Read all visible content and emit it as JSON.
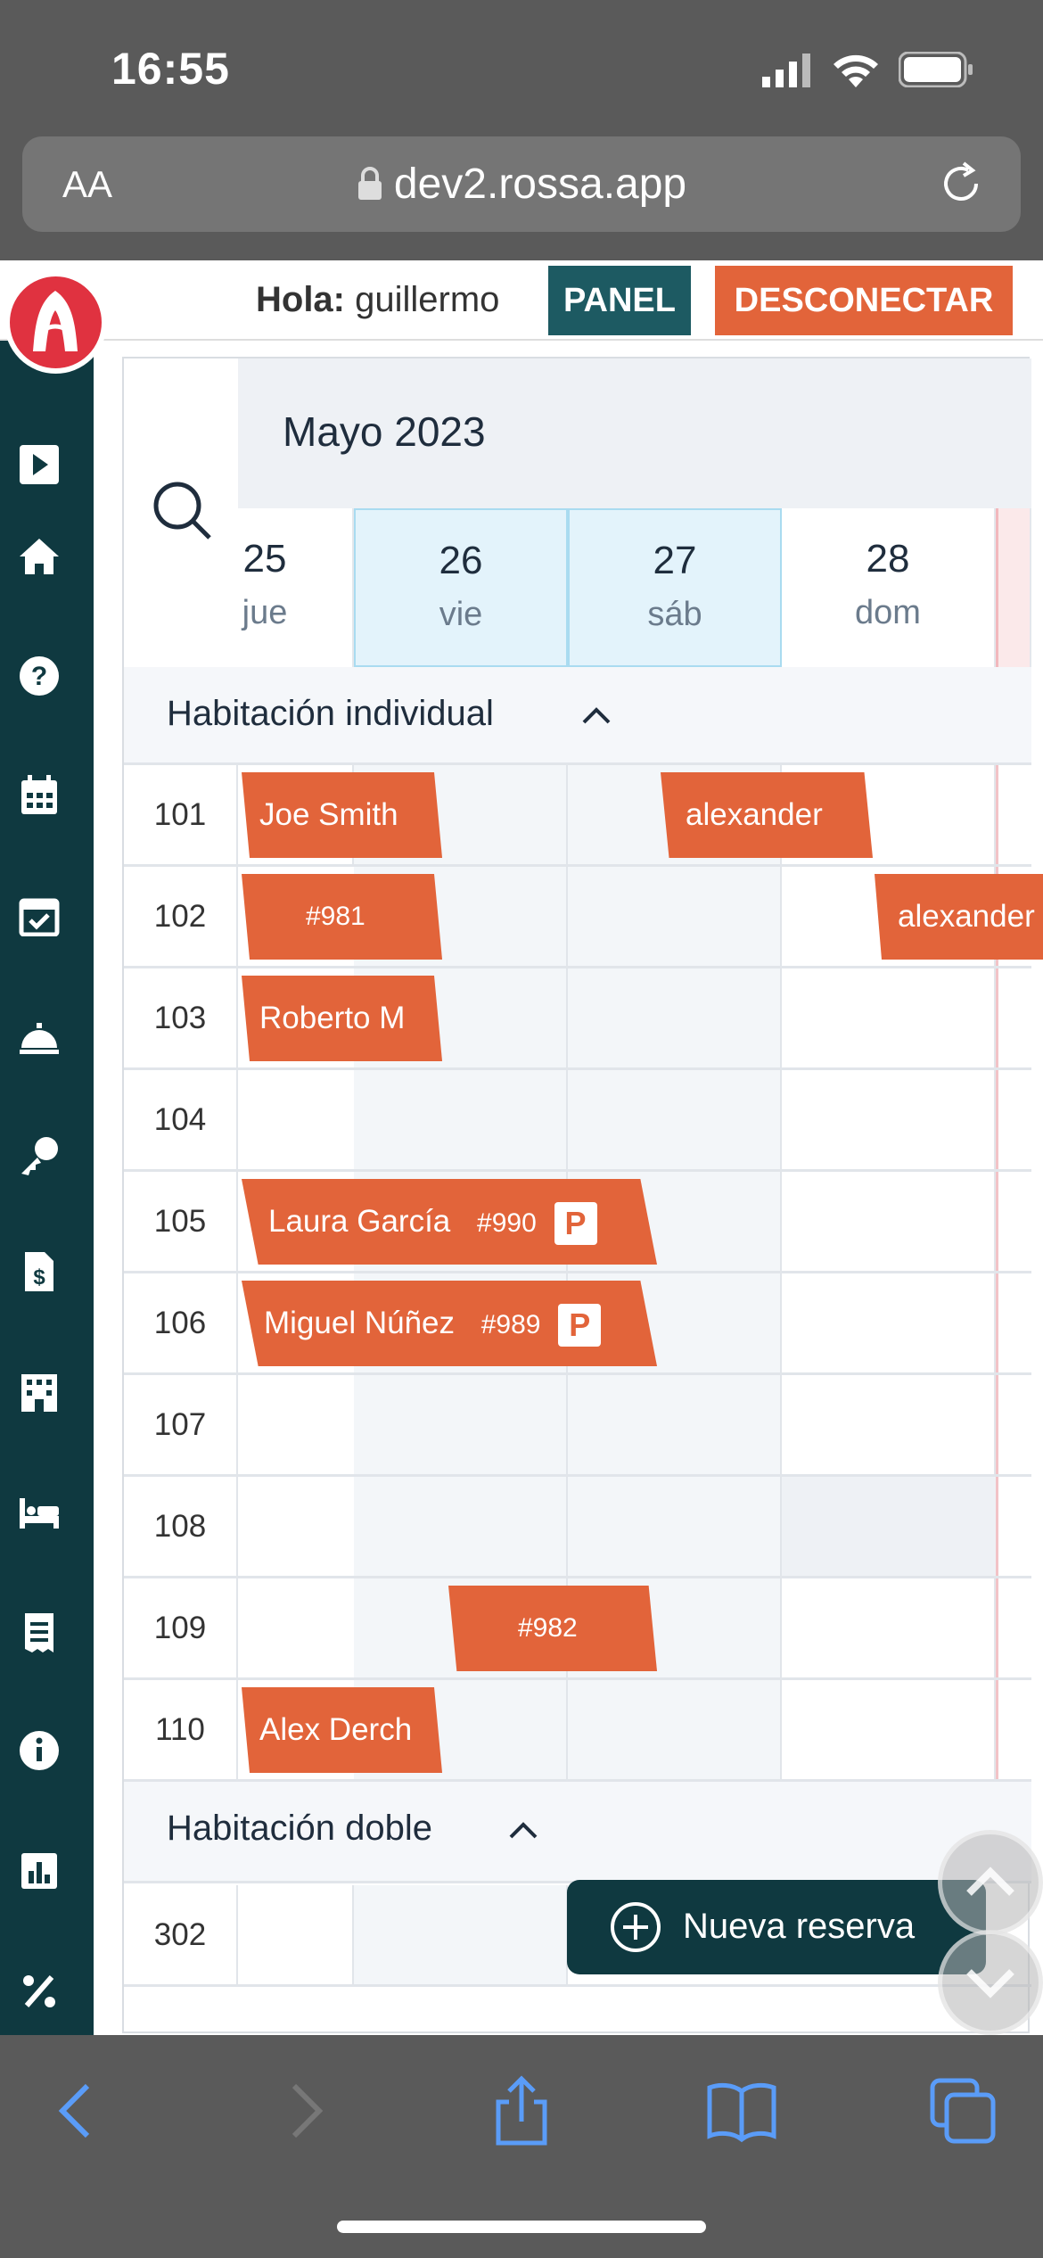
{
  "status_bar": {
    "time": "16:55"
  },
  "browser": {
    "text_size_label": "AA",
    "url": "dev2.rossa.app"
  },
  "header": {
    "greeting_label": "Hola:",
    "username": "guillermo",
    "panel_button": "PANEL",
    "logout_button": "DESCONECTAR"
  },
  "sidebar": {
    "icons": [
      "play-icon",
      "home-icon",
      "help-icon",
      "calendar-icon",
      "calendar-check-icon",
      "concierge-bell-icon",
      "key-icon",
      "invoice-icon",
      "building-icon",
      "bed-icon",
      "receipt-icon",
      "info-icon",
      "chart-icon",
      "percent-icon"
    ]
  },
  "calendar": {
    "month_label": "Mayo 2023",
    "days": [
      {
        "num": "25",
        "name": "jue"
      },
      {
        "num": "26",
        "name": "vie"
      },
      {
        "num": "27",
        "name": "sáb"
      },
      {
        "num": "28",
        "name": "dom"
      }
    ],
    "sections": [
      {
        "title": "Habitación individual"
      },
      {
        "title": "Habitación doble"
      }
    ],
    "rooms": [
      "101",
      "102",
      "103",
      "104",
      "105",
      "106",
      "107",
      "108",
      "109",
      "110",
      "302"
    ],
    "reservations": [
      {
        "label": "Joe Smith"
      },
      {
        "label": "alexander"
      },
      {
        "label": "#981"
      },
      {
        "label": "alexander"
      },
      {
        "label": "Roberto M"
      },
      {
        "label": "Laura García",
        "code": "#990",
        "badge": "P"
      },
      {
        "label": "Miguel Núñez",
        "code": "#989",
        "badge": "P"
      },
      {
        "label": "#982"
      },
      {
        "label": "Alex Derch"
      }
    ]
  },
  "fab": {
    "label": "Nueva reserva"
  },
  "colors": {
    "primary": "#e2643a",
    "dark": "#0f3940",
    "panel": "#1d5a62",
    "brand": "#e03240"
  }
}
